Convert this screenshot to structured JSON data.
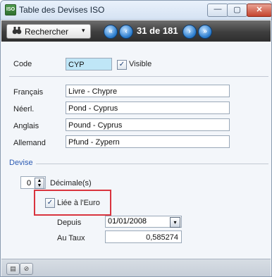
{
  "window": {
    "title": "Table des Devises ISO",
    "app_icon_text": "ISO",
    "controls": {
      "minimize": "—",
      "maximize": "▢",
      "close": "✕"
    }
  },
  "toolbar": {
    "search_label": "Rechercher",
    "search_icon": "binoculars-icon",
    "dropdown_glyph": "▾",
    "nav_count": "31 de 181",
    "nav_first_glyph": "«",
    "nav_prev_glyph": "‹",
    "nav_next_glyph": "›",
    "nav_last_glyph": "»"
  },
  "form": {
    "code_label": "Code",
    "code_value": "CYP",
    "visible_label": "Visible",
    "visible_checked": true,
    "names": [
      {
        "label": "Français",
        "value": "Livre - Chypre"
      },
      {
        "label": "Néerl.",
        "value": "Pond - Cyprus"
      },
      {
        "label": "Anglais",
        "value": "Pound - Cyprus"
      },
      {
        "label": "Allemand",
        "value": "Pfund - Zypern"
      }
    ]
  },
  "devise": {
    "section_label": "Devise",
    "decimals_value": "0",
    "decimals_label": "Décimale(s)",
    "euro_label": "Liée à l'Euro",
    "euro_checked": true,
    "depuis_label": "Depuis",
    "depuis_value": "01/01/2008",
    "taux_label": "Au Taux",
    "taux_value": "0,585274"
  },
  "checkmark": "✓",
  "colors": {
    "accent": "#2c5bb3",
    "highlight": "#d9343e"
  }
}
